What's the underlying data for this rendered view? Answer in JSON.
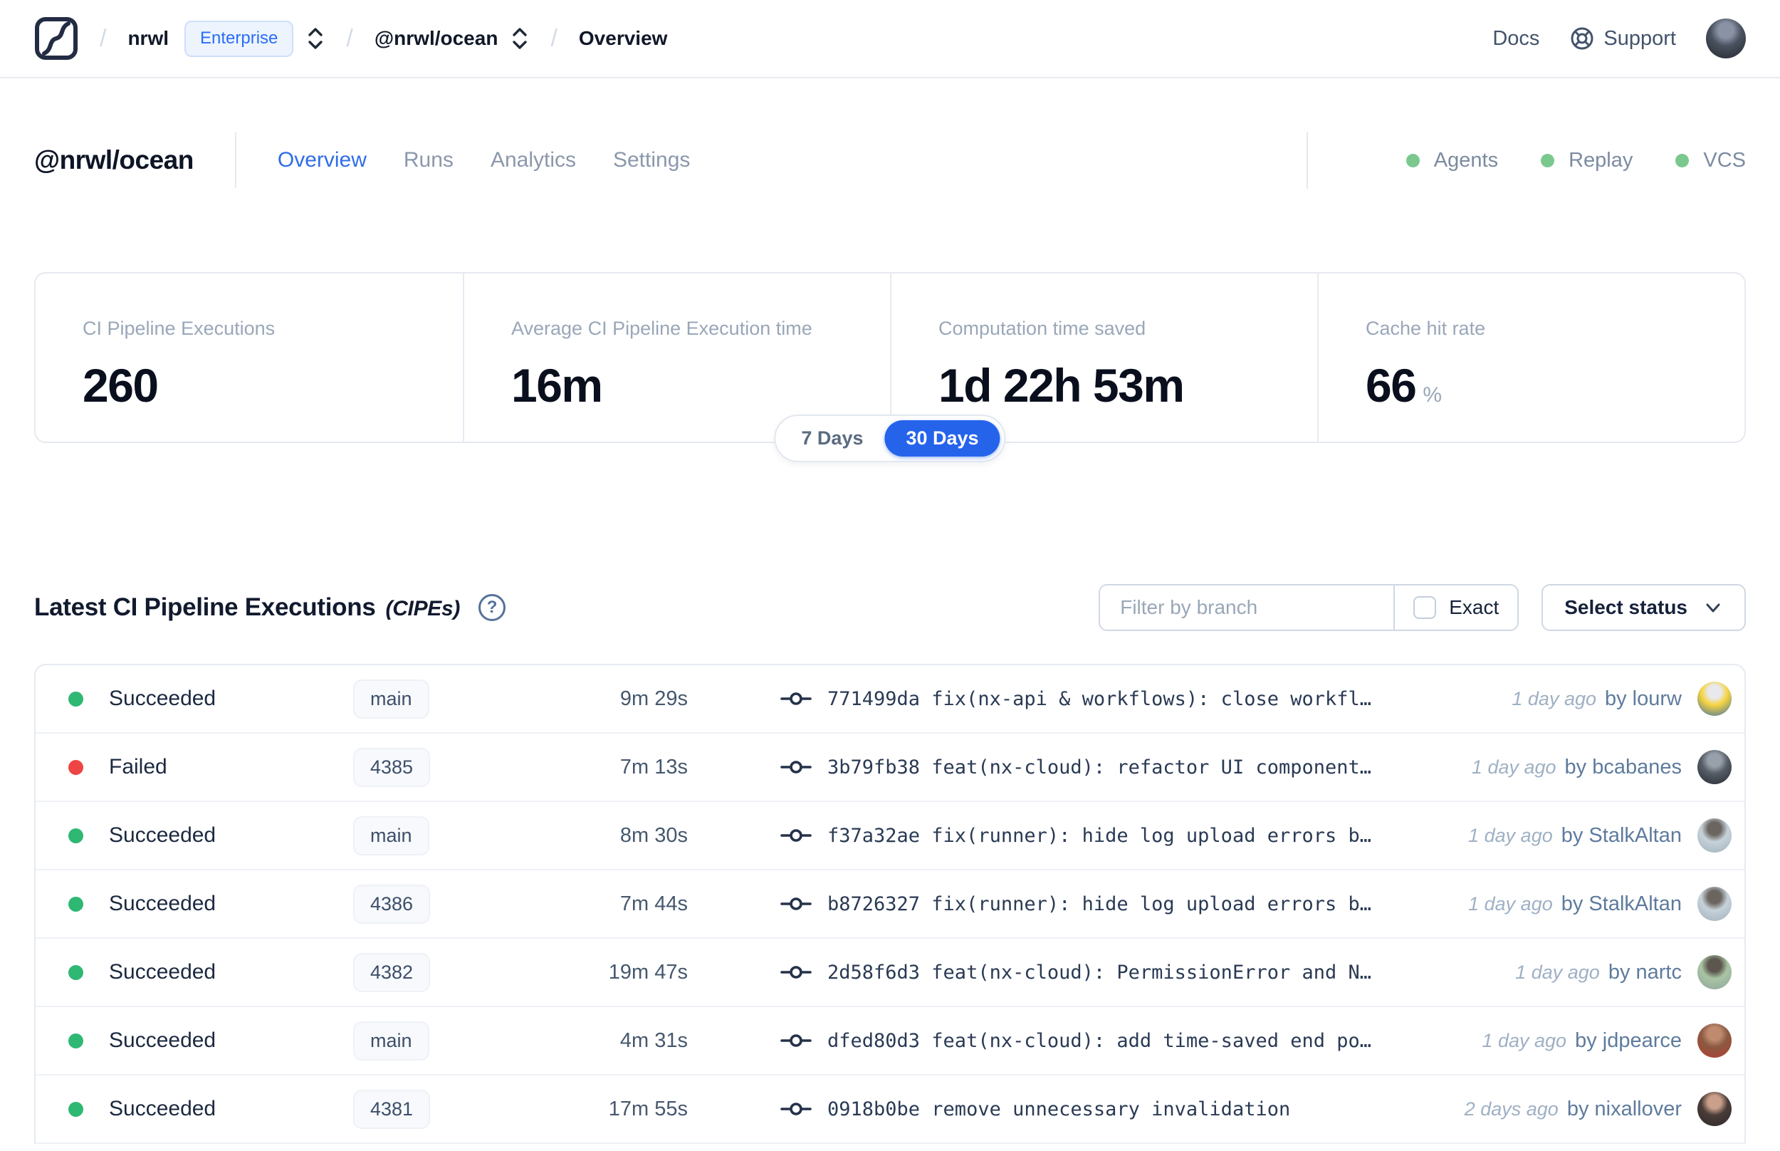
{
  "navbar": {
    "breadcrumb": {
      "org": "nrwl",
      "org_badge": "Enterprise",
      "workspace": "@nrwl/ocean",
      "page": "Overview"
    },
    "links": {
      "docs": "Docs",
      "support": "Support"
    },
    "user_avatar_colors": [
      "#8a93a5",
      "#4a525f",
      "#23282e"
    ]
  },
  "header": {
    "title": "@nrwl/ocean",
    "tabs": [
      {
        "label": "Overview",
        "active": true
      },
      {
        "label": "Runs",
        "active": false
      },
      {
        "label": "Analytics",
        "active": false
      },
      {
        "label": "Settings",
        "active": false
      }
    ],
    "status_indicators": [
      {
        "label": "Agents"
      },
      {
        "label": "Replay"
      },
      {
        "label": "VCS"
      }
    ]
  },
  "stats": {
    "cards": [
      {
        "label": "CI Pipeline Executions",
        "value": "260",
        "unit": ""
      },
      {
        "label": "Average CI Pipeline Execution time",
        "value": "16m",
        "unit": ""
      },
      {
        "label": "Computation time saved",
        "value": "1d 22h 53m",
        "unit": ""
      },
      {
        "label": "Cache hit rate",
        "value": "66",
        "unit": "%"
      }
    ],
    "range_toggle": {
      "options": [
        "7 Days",
        "30 Days"
      ],
      "selected": "30 Days"
    }
  },
  "table": {
    "title": "Latest CI Pipeline Executions",
    "title_suffix": "(CIPEs)",
    "help_glyph": "?",
    "filter": {
      "branch_placeholder": "Filter by branch",
      "branch_value": "",
      "exact_label": "Exact",
      "exact_checked": false,
      "status_label": "Select status"
    },
    "rows": [
      {
        "status": "Succeeded",
        "status_color": "green",
        "branch": "main",
        "duration": "9m 29s",
        "commit": "771499da fix(nx-api & workflows): close workfl…",
        "time_ago": "1 day ago",
        "author": "by lourw",
        "avatar_colors": [
          "#e8e9ec",
          "#f6d33e",
          "#3a6fae"
        ]
      },
      {
        "status": "Failed",
        "status_color": "red",
        "branch": "4385",
        "duration": "7m 13s",
        "commit": "3b79fb38 feat(nx-cloud): refactor UI component…",
        "time_ago": "1 day ago",
        "author": "by bcabanes",
        "avatar_colors": [
          "#98a1ab",
          "#565d66",
          "#262a30"
        ]
      },
      {
        "status": "Succeeded",
        "status_color": "green",
        "branch": "main",
        "duration": "8m 30s",
        "commit": "f37a32ae fix(runner): hide log upload errors b…",
        "time_ago": "1 day ago",
        "author": "by StalkAltan",
        "avatar_colors": [
          "#6b6560",
          "#c7d2da",
          "#9fb0ba"
        ]
      },
      {
        "status": "Succeeded",
        "status_color": "green",
        "branch": "4386",
        "duration": "7m 44s",
        "commit": "b8726327 fix(runner): hide log upload errors b…",
        "time_ago": "1 day ago",
        "author": "by StalkAltan",
        "avatar_colors": [
          "#6b6560",
          "#c7d2da",
          "#9fb0ba"
        ]
      },
      {
        "status": "Succeeded",
        "status_color": "green",
        "branch": "4382",
        "duration": "19m 47s",
        "commit": "2d58f6d3 feat(nx-cloud): PermissionError and N…",
        "time_ago": "1 day ago",
        "author": "by nartc",
        "avatar_colors": [
          "#5c564f",
          "#a9c5a4",
          "#8fa39c"
        ]
      },
      {
        "status": "Succeeded",
        "status_color": "green",
        "branch": "main",
        "duration": "4m 31s",
        "commit": "dfed80d3 feat(nx-cloud): add time-saved end po…",
        "time_ago": "1 day ago",
        "author": "by jdpearce",
        "avatar_colors": [
          "#c08a6e",
          "#8a5a42",
          "#b63c33"
        ]
      },
      {
        "status": "Succeeded",
        "status_color": "green",
        "branch": "4381",
        "duration": "17m 55s",
        "commit": "0918b0be remove unnecessary invalidation",
        "time_ago": "2 days ago",
        "author": "by nixallover",
        "avatar_colors": [
          "#caa08b",
          "#4a3c38",
          "#2e2a2a"
        ]
      }
    ]
  },
  "icons": {
    "logo": "nx-cloud-logo",
    "breadcrumb_selector": "chevron-up-down-icon",
    "support": "lifebuoy-icon",
    "help": "question-circle-icon",
    "commit": "git-commit-icon",
    "select": "chevron-down-icon"
  },
  "colors": {
    "accent_blue": "#2563eb",
    "tab_active": "#2f6de8",
    "success_green": "#2eb873",
    "failed_red": "#ee4444",
    "env_dot_green": "#7bc88f",
    "badge_blue_text": "#2a6df5"
  }
}
